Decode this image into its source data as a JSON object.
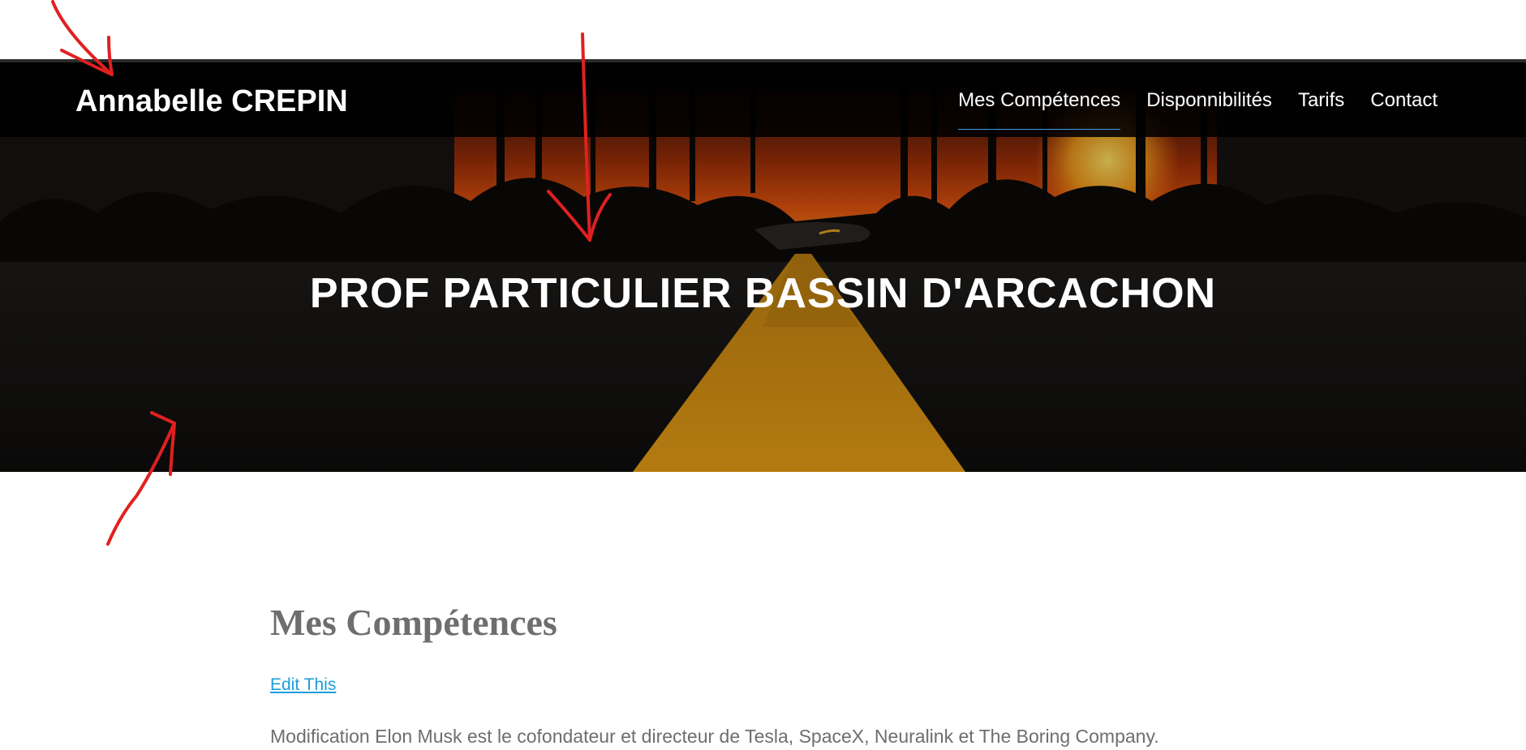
{
  "header": {
    "brand": "Annabelle CREPIN",
    "nav": [
      {
        "label": "Mes Compétences",
        "active": true
      },
      {
        "label": "Disponnibilités",
        "active": false
      },
      {
        "label": "Tarifs",
        "active": false
      },
      {
        "label": "Contact",
        "active": false
      }
    ]
  },
  "hero": {
    "title": "PROF PARTICULIER BASSIN D'ARCACHON",
    "image": "sunset-road-photo"
  },
  "main": {
    "section_title": "Mes Compétences",
    "edit_link": "Edit This",
    "body_text": "Modification Elon Musk est le cofondateur et directeur de Tesla, SpaceX, Neuralink et The Boring Company."
  },
  "colors": {
    "accent": "#3da0e6",
    "link": "#1a9fd9",
    "text_muted": "#6e6e6e",
    "annotation": "#e02020"
  }
}
